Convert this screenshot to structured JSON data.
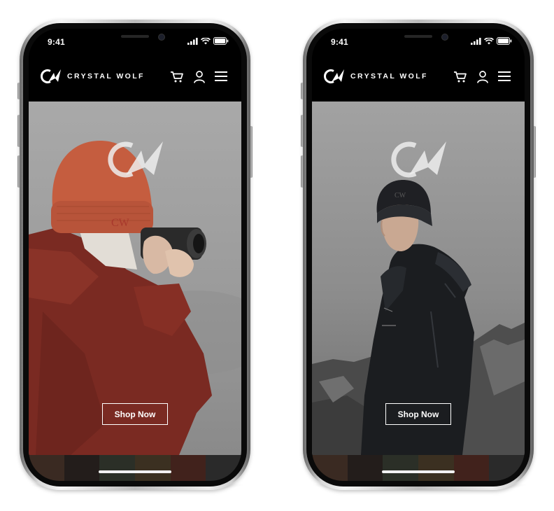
{
  "phones": [
    {
      "status_time": "9:41",
      "brand": "CRYSTAL WOLF",
      "cta_label": "Shop Now",
      "hero_subject": "photographer in red jacket and orange beanie"
    },
    {
      "status_time": "9:41",
      "brand": "CRYSTAL WOLF",
      "cta_label": "Shop Now",
      "hero_subject": "man in black jacket and black beanie on mountain"
    }
  ],
  "icons": {
    "cart": "cart-icon",
    "account": "user-icon",
    "menu": "hamburger-menu-icon",
    "signal": "signal-icon",
    "wifi": "wifi-icon",
    "battery": "battery-icon"
  },
  "colors": {
    "header_bg": "#000000",
    "hero_fog": "#9a9a9a",
    "jacket_red": "#7a2a22",
    "beanie_orange": "#c45a3e",
    "jacket_black": "#1b1d20"
  }
}
